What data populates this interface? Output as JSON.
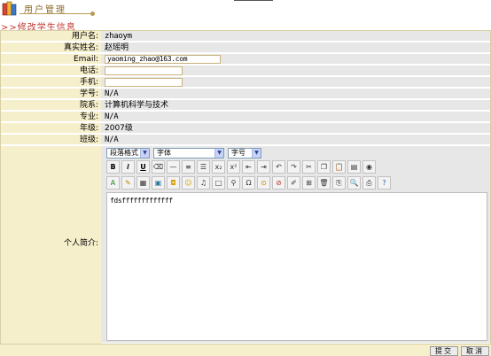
{
  "header": {
    "title": "用户管理",
    "icon": "books-icon"
  },
  "section_title": ">>修改学生信息",
  "fields": [
    {
      "label": "用户名:",
      "value": "zhaoym"
    },
    {
      "label": "真实姓名:",
      "value": "赵瑶明"
    },
    {
      "label": "Email:",
      "value": "yaoming_zhao@163.com"
    },
    {
      "label": "电话:",
      "value": ""
    },
    {
      "label": "手机:",
      "value": ""
    },
    {
      "label": "学号:",
      "value": "N/A"
    },
    {
      "label": "院系:",
      "value": "计算机科学与技术"
    },
    {
      "label": "专业:",
      "value": "N/A"
    },
    {
      "label": "年级:",
      "value": "2007级"
    },
    {
      "label": "班级:",
      "value": "N/A"
    }
  ],
  "editor": {
    "label": "个人简介:",
    "paragraph_select": "段落格式",
    "font_select": "字体",
    "size_select": "字号",
    "content": "fdsfffffffffffff"
  },
  "buttons": {
    "submit": "提交",
    "cancel": "取消"
  },
  "colors": {
    "label_bg": "#f6efcc",
    "value_bg": "#e7e7e7",
    "section_title": "#c0362c",
    "header_title": "#8a6d2a"
  }
}
